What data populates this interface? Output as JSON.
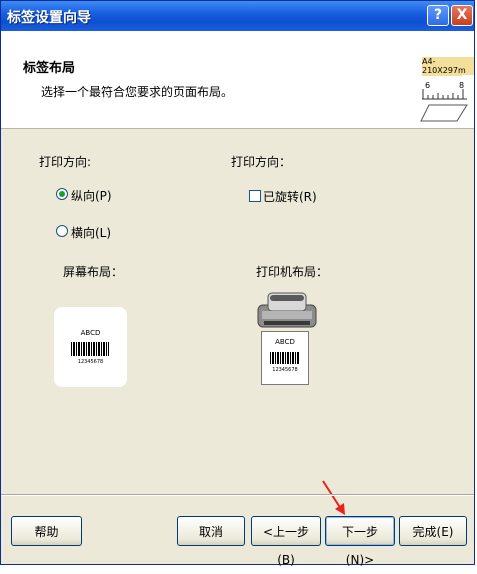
{
  "window": {
    "title": "标签设置向导",
    "help_glyph": "?",
    "close_glyph": "X"
  },
  "header": {
    "title": "标签布局",
    "subtitle": "选择一个最符合您要求的页面布局。",
    "icon": "ruler-icon",
    "ruler_label": "A4-210X297m",
    "ruler_tick_left": "6",
    "ruler_tick_right": "8"
  },
  "orientation": {
    "label": "打印方向:",
    "options": [
      {
        "label": "纵向(P)",
        "selected": true
      },
      {
        "label": "横向(L)",
        "selected": false
      }
    ]
  },
  "rotation": {
    "label": "打印方向：",
    "checkbox_label": "已旋转(R)",
    "checked": false
  },
  "screen_layout": {
    "label": "屏幕布局：",
    "card_text": "ABCD",
    "card_number": "12345678"
  },
  "printer_layout": {
    "label": "打印机布局：",
    "card_text": "ABCD",
    "card_number": "12345678",
    "icon": "printer-icon"
  },
  "buttons": {
    "help": "帮助",
    "cancel": "取消",
    "back": "<上一步(B)",
    "next": "下一步(N)>",
    "finish": "完成(E)"
  },
  "colors": {
    "titlebar": "#0d4fd2",
    "dialog_bg": "#ece9d8",
    "radio_dot": "#1a9e2a",
    "annotation_arrow": "#e8221d"
  }
}
